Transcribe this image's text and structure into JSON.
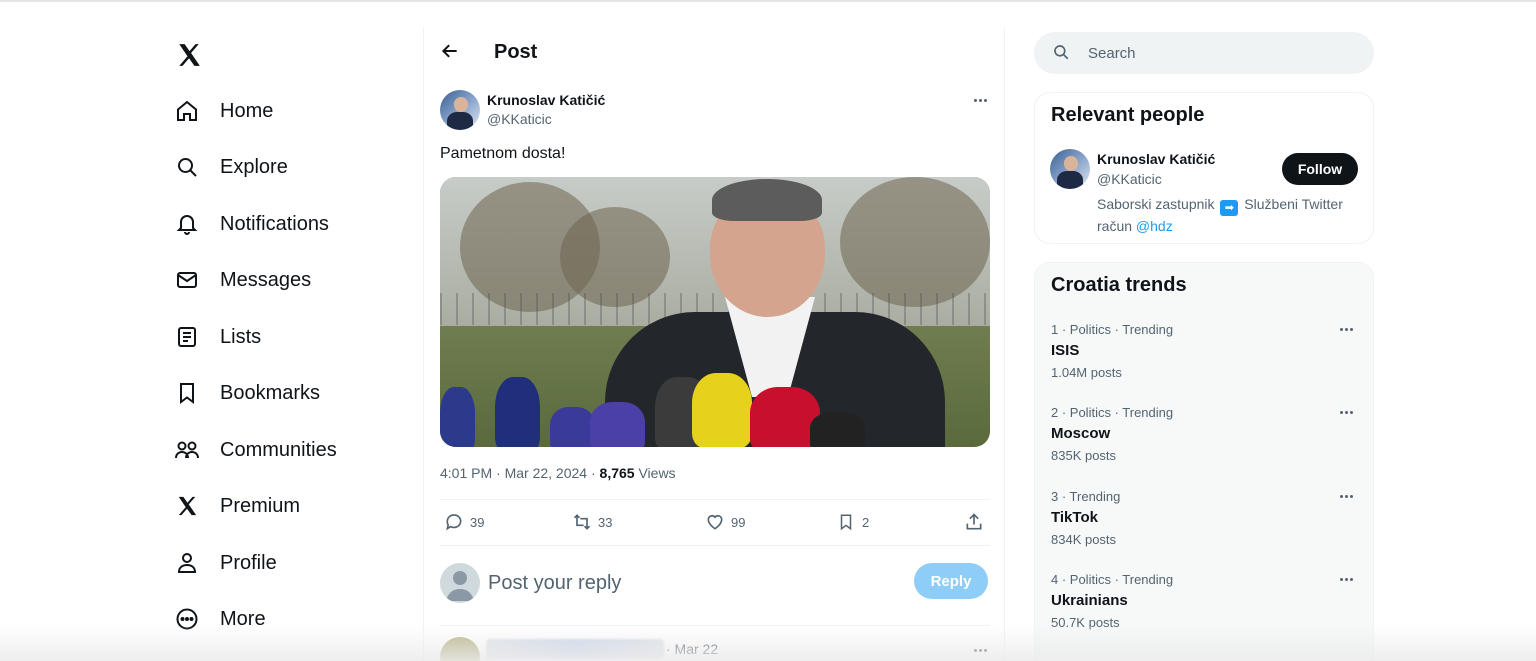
{
  "nav": {
    "items": [
      {
        "label": "Home",
        "icon": "home-icon"
      },
      {
        "label": "Explore",
        "icon": "search-icon"
      },
      {
        "label": "Notifications",
        "icon": "bell-icon"
      },
      {
        "label": "Messages",
        "icon": "envelope-icon"
      },
      {
        "label": "Lists",
        "icon": "list-icon"
      },
      {
        "label": "Bookmarks",
        "icon": "bookmark-icon"
      },
      {
        "label": "Communities",
        "icon": "people-icon"
      },
      {
        "label": "Premium",
        "icon": "x-logo-icon"
      },
      {
        "label": "Profile",
        "icon": "person-icon"
      },
      {
        "label": "More",
        "icon": "more-circle-icon"
      }
    ]
  },
  "header": {
    "title": "Post"
  },
  "tweet": {
    "author_name": "Krunoslav Katičić",
    "author_handle": "@KKaticic",
    "text": "Pametnom dosta!",
    "time": "4:01 PM · Mar 22, 2024 · ",
    "views_count": "8,765",
    "views_label": " Views",
    "stats": {
      "replies": "39",
      "reposts": "33",
      "likes": "99",
      "bookmarks": "2"
    }
  },
  "reply": {
    "placeholder": "Post your reply",
    "button_label": "Reply"
  },
  "next_post": {
    "date": "· Mar 22"
  },
  "search": {
    "placeholder": "Search"
  },
  "relevant_people": {
    "title": "Relevant people",
    "name": "Krunoslav Katičić",
    "handle": "@KKaticic",
    "follow_label": "Follow",
    "bio_part1": "Saborski zastupnik ",
    "bio_part2": " Službeni Twitter račun ",
    "bio_mention": "@hdz"
  },
  "trends": {
    "title": "Croatia trends",
    "items": [
      {
        "context": "1 · Politics · Trending",
        "name": "ISIS",
        "posts": "1.04M posts"
      },
      {
        "context": "2 · Politics · Trending",
        "name": "Moscow",
        "posts": "835K posts"
      },
      {
        "context": "3 · Trending",
        "name": "TikTok",
        "posts": "834K posts"
      },
      {
        "context": "4 · Politics · Trending",
        "name": "Ukrainians",
        "posts": "50.7K posts"
      }
    ]
  },
  "colors": {
    "accent": "#1d9bf0",
    "text": "#0f1419",
    "secondary": "#536471",
    "reply_button": "#8ecdf8"
  }
}
